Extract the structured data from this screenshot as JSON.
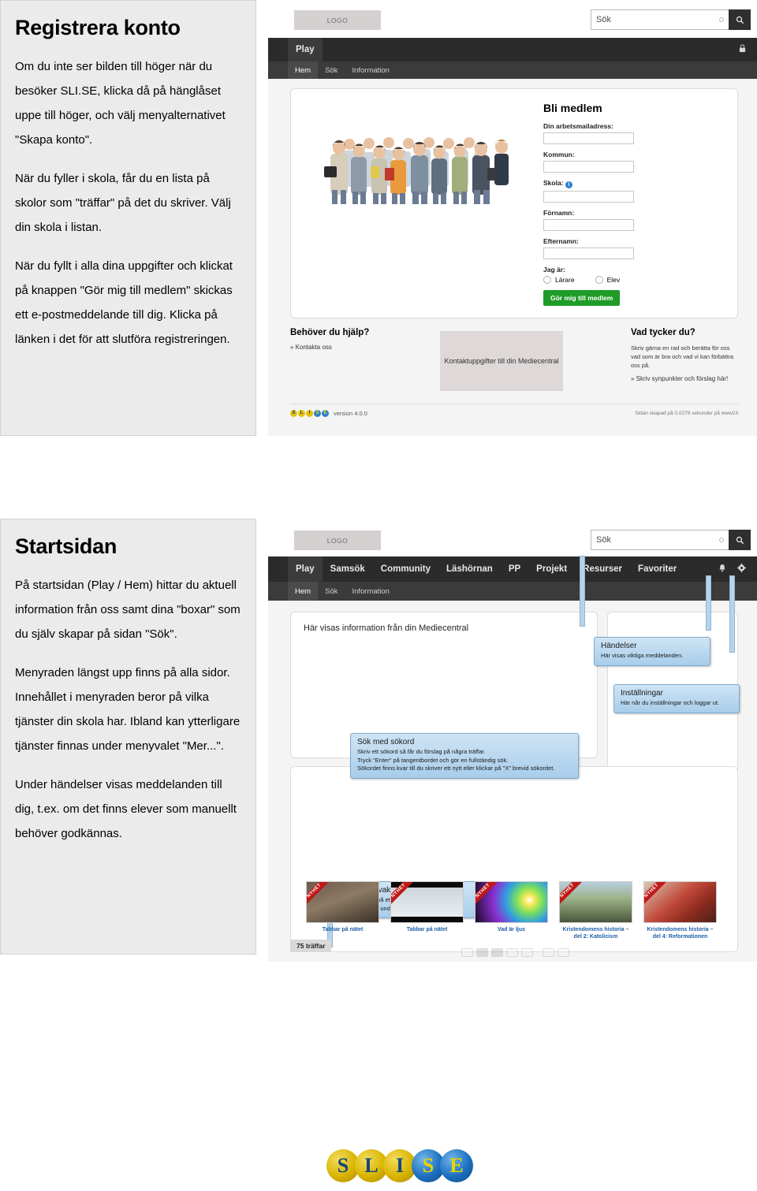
{
  "sections": [
    {
      "id": "registrera-konto",
      "title": "Registrera konto",
      "paragraphs": [
        "Om du inte ser bilden till höger när du besöker SLI.SE, klicka då på hänglåset uppe till höger, och välj menyalternativet \"Skapa konto\".",
        "När du fyller i skola, får du en lista på skolor som \"träffar\" på det du skriver. Välj din skola i listan.",
        "När du fyllt i alla dina uppgifter och klickat på knappen \"Gör mig till medlem\" skickas ett e-postmeddelande till dig. Klicka på länken i det för att slutföra registreringen."
      ]
    },
    {
      "id": "startsidan",
      "title": "Startsidan",
      "paragraphs": [
        "På startsidan (Play / Hem) hittar du aktuell information från oss samt dina \"boxar\" som du själv skapar på sidan \"Sök\".",
        "Menyraden längst upp finns på alla sidor. Innehållet i menyraden beror på vilka tjänster din skola har. Ibland kan ytterligare tjänster finnas under menyvalet \"Mer...\".",
        "Under händelser visas meddelanden till dig, t.ex. om det finns elever som manuellt behöver godkännas."
      ]
    }
  ],
  "shot1": {
    "logo_label": "LOGO",
    "search": {
      "placeholder": "Sök",
      "button_icon": "search-icon"
    },
    "nav": [
      {
        "label": "Play",
        "active": true
      }
    ],
    "nav_right": [
      {
        "icon": "lock-icon",
        "glyph": "🔒"
      }
    ],
    "subnav": [
      {
        "label": "Hem",
        "active": true
      },
      {
        "label": "Sök",
        "active": false
      },
      {
        "label": "Information",
        "active": false
      }
    ],
    "form": {
      "title": "Bli medlem",
      "fields": [
        {
          "label": "Din arbetsmailadress:",
          "value": ""
        },
        {
          "label": "Kommun:",
          "value": ""
        },
        {
          "label": "Skola:",
          "value": "",
          "info": true
        },
        {
          "label": "Förnamn:",
          "value": ""
        },
        {
          "label": "Efternamn:",
          "value": ""
        }
      ],
      "radio_label": "Jag är:",
      "radios": [
        "Lärare",
        "Elev"
      ],
      "submit": "Gör mig till medlem"
    },
    "footer": {
      "help_title": "Behöver du hjälp?",
      "help_link": "» Kontakta oss",
      "media_box": "Kontaktuppgifter till din Mediecentral",
      "feedback_title": "Vad tycker du?",
      "feedback_body": "Skriv gärna en rad och berätta för oss vad som är bra och vad vi kan förbättra oss på.",
      "feedback_link": "» Skriv synpunkter och förslag här!",
      "version": "version 4.0.0",
      "generated": "Sidan skapad på 0,0279 sekunder på www23",
      "logo_letters": [
        "S",
        "L",
        "I",
        "S",
        "E"
      ]
    }
  },
  "shot2": {
    "logo_label": "LOGO",
    "search": {
      "placeholder": "Sök",
      "button_icon": "search-icon"
    },
    "nav": [
      {
        "label": "Play",
        "active": true
      },
      {
        "label": "Samsök",
        "active": false
      },
      {
        "label": "Community",
        "active": false
      },
      {
        "label": "Läshörnan",
        "active": false
      },
      {
        "label": "PP",
        "active": false
      },
      {
        "label": "Projekt",
        "active": false
      },
      {
        "label": "Resurser",
        "active": false
      },
      {
        "label": "Favoriter",
        "active": false
      }
    ],
    "nav_right": [
      {
        "icon": "bell-icon",
        "glyph": "🔔"
      },
      {
        "icon": "gear-icon",
        "glyph": "⚙"
      }
    ],
    "subnav": [
      {
        "label": "Hem",
        "active": true
      },
      {
        "label": "Sök",
        "active": false
      },
      {
        "label": "Information",
        "active": false
      }
    ],
    "info_text": "Här visas information från din Mediecentral",
    "callouts": [
      {
        "name": "sok-med-sokord",
        "title": "Sök med sökord",
        "lines": [
          "Skriv ett sökord så får du förslag på några träffar.",
          "Tryck \"Enter\" på tangentbordet och gör en fullständig sök.",
          "Sökordet finns kvar till du skriver ett nytt eller klickar på \"X\" brevid sökordet."
        ]
      },
      {
        "name": "handelser",
        "title": "Händelser",
        "lines": [
          "Här visas viktiga meddelanden."
        ]
      },
      {
        "name": "installningar",
        "title": "Inställningar",
        "lines": [
          "Här når du inställningar och loggar ut."
        ]
      },
      {
        "name": "personlig-bevakning",
        "title": "Personlig bevakning",
        "lines": [
          "Bevaka nyheter på ett sökord och/eller ämne.",
          "Du skapar dessa under \"Sök\" i den grå menyn."
        ]
      }
    ],
    "hits_label": "75 träffar",
    "ribbon_label": "NYHET",
    "thumbnails": [
      {
        "caption": "Tabbar på nätet"
      },
      {
        "caption": "Tabbar på nätet"
      },
      {
        "caption": "Vad är ljus"
      },
      {
        "caption": "Kristendomens historia – del 2: Katolicism"
      },
      {
        "caption": "Kristendomens historia – del 4: Reformationen"
      }
    ]
  },
  "brand": {
    "logo_letters": [
      "S",
      "L",
      "I",
      "S",
      "E"
    ],
    "colors": {
      "gold": "#d9b400",
      "blue": "#1d6fc0",
      "accent_green": "#1f9b27",
      "nav_dark": "#2b2b2b"
    }
  }
}
